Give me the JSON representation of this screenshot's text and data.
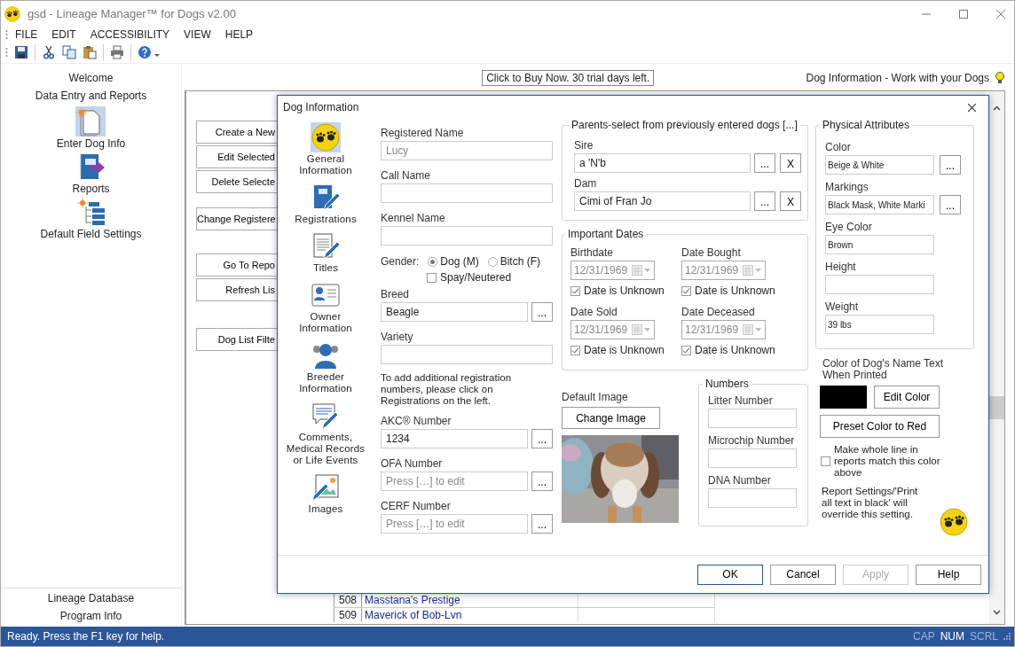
{
  "window": {
    "title": "gsd - Lineage Manager™ for Dogs v2.00"
  },
  "menu": [
    "FILE",
    "EDIT",
    "ACCESSIBILITY",
    "VIEW",
    "HELP"
  ],
  "sidebar": {
    "items": [
      {
        "label": "Welcome",
        "kind": "heading",
        "selected": false
      },
      {
        "label": "Data Entry and Reports",
        "kind": "heading",
        "selected": false
      },
      {
        "label": "Enter Dog Info",
        "kind": "tool",
        "selected": true
      },
      {
        "label": "Reports",
        "kind": "tool",
        "selected": false
      },
      {
        "label": "Default Field Settings",
        "kind": "tool",
        "selected": false
      }
    ],
    "footer": [
      "Lineage Database",
      "Program Info"
    ]
  },
  "banner": "Click to Buy Now. 30 trial days left.",
  "page_title": "Dog Information - Work with your Dogs",
  "action_groups": [
    [
      "Create a New",
      "Edit Selected",
      "Delete Selecte"
    ],
    [
      "Change Registere"
    ],
    [
      "Go To Repo",
      "Refresh Lis"
    ],
    [
      "Dog List Filte"
    ]
  ],
  "dog_list": {
    "rows": [
      {
        "number": "508",
        "name": "Masstana's Prestige"
      },
      {
        "number": "509",
        "name": "Maverick of Bob-Lvn"
      }
    ]
  },
  "dialog": {
    "title": "Dog Information",
    "nav": [
      {
        "label": "General Information",
        "selected": true
      },
      {
        "label": "Registrations",
        "selected": false
      },
      {
        "label": "Titles",
        "selected": false
      },
      {
        "label": "Owner Information",
        "selected": false
      },
      {
        "label": "Breeder Information",
        "selected": false
      },
      {
        "label": "Comments, Medical Records or Life Events",
        "selected": false
      },
      {
        "label": "Images",
        "selected": false
      }
    ],
    "general": [
      {
        "kind": "field",
        "label": "Registered Name",
        "value": "Lucy",
        "disabled": true
      },
      {
        "kind": "field",
        "label": "Call Name"
      },
      {
        "kind": "field",
        "label": "Kennel Name"
      },
      {
        "kind": "radio",
        "label": "Gender:",
        "options": [
          {
            "label": "Dog (M)",
            "selected": true
          },
          {
            "label": "Bitch (F)",
            "selected": false
          }
        ]
      },
      {
        "kind": "checkbox",
        "label": "Spay/Neutered",
        "checked": false
      },
      {
        "kind": "field",
        "label": "Breed",
        "value": "Beagle",
        "button": "..."
      },
      {
        "kind": "field",
        "label": "Variety"
      },
      {
        "kind": "note",
        "label": "To add additional registration numbers, please click on Registrations on the left."
      },
      {
        "kind": "field",
        "label": "AKC® Number",
        "value": "1234",
        "button": "..."
      },
      {
        "kind": "field",
        "label": "OFA Number",
        "placeholder": "Press […] to edit",
        "button": "..."
      },
      {
        "kind": "field",
        "label": "CERF Number",
        "placeholder": "Press […] to edit",
        "button": "..."
      }
    ],
    "parents": {
      "legend": "Parents-select from previously entered dogs [...]",
      "fields": [
        {
          "label": "Sire",
          "value": "a 'N'b",
          "buttons": [
            "...",
            "X"
          ]
        },
        {
          "label": "Dam",
          "value": "Cimi of Fran Jo",
          "buttons": [
            "...",
            "X"
          ]
        }
      ]
    },
    "dates": {
      "legend": "Important Dates",
      "items": [
        {
          "label": "Birthdate",
          "value": "12/31/1969",
          "disabled": true,
          "unknown": {
            "label": "Date is Unknown",
            "checked": true
          }
        },
        {
          "label": "Date Bought",
          "value": "12/31/1969",
          "disabled": true,
          "unknown": {
            "label": "Date is Unknown",
            "checked": true
          }
        },
        {
          "label": "Date Sold",
          "value": "12/31/1969",
          "disabled": true,
          "unknown": {
            "label": "Date is Unknown",
            "checked": true
          }
        },
        {
          "label": "Date Deceased",
          "value": "12/31/1969",
          "disabled": true,
          "unknown": {
            "label": "Date is Unknown",
            "checked": true
          }
        }
      ]
    },
    "image": {
      "label": "Default Image",
      "button": "Change Image",
      "kind": "picture"
    },
    "numbers": {
      "legend": "Numbers",
      "fields": [
        {
          "label": "Litter Number"
        },
        {
          "label": "Microchip Number"
        },
        {
          "label": "DNA Number"
        }
      ]
    },
    "physical": {
      "legend": "Physical Attributes",
      "fields": [
        {
          "label": "Color",
          "value": "Beige & White",
          "button": "..."
        },
        {
          "label": "Markings",
          "value": "Black Mask, White Marki",
          "button": "..."
        },
        {
          "label": "Eye Color",
          "value": "Brown"
        },
        {
          "label": "Height"
        },
        {
          "label": "Weight",
          "value": "39 lbs"
        }
      ]
    },
    "name_color": {
      "label": "Color of Dog's Name Text When Printed",
      "color": "#000000",
      "edit_button": "Edit Color",
      "preset_button": "Preset Color to Red",
      "match_line": {
        "label": "Make whole line in reports match this color above",
        "checked": false
      },
      "note": "Report Settings/'Print all text in black' will override this setting."
    },
    "buttons": [
      {
        "label": "OK",
        "default": true,
        "disabled": false
      },
      {
        "label": "Cancel",
        "default": false,
        "disabled": false
      },
      {
        "label": "Apply",
        "default": false,
        "disabled": true
      },
      {
        "label": "Help",
        "default": false,
        "disabled": false
      }
    ]
  },
  "status_bar": {
    "text": "Ready. Press the F1 key for help.",
    "indicators": [
      {
        "label": "CAP",
        "on": false
      },
      {
        "label": "NUM",
        "on": true
      },
      {
        "label": "SCRL",
        "on": false
      }
    ]
  }
}
